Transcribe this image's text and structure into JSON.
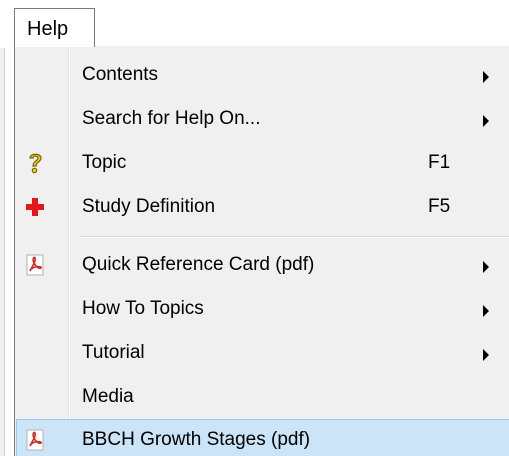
{
  "menu": {
    "title": "Help",
    "items": [
      {
        "label": "Contents",
        "shortcut": "",
        "submenu": true,
        "icon": ""
      },
      {
        "label": "Search for Help On...",
        "shortcut": "",
        "submenu": true,
        "icon": ""
      },
      {
        "label": "Topic",
        "shortcut": "F1",
        "submenu": false,
        "icon": "question-icon"
      },
      {
        "label": "Study Definition",
        "shortcut": "F5",
        "submenu": false,
        "icon": "red-cross-icon"
      },
      {
        "label": "Quick Reference Card (pdf)",
        "shortcut": "",
        "submenu": true,
        "icon": "pdf-icon"
      },
      {
        "label": "How To Topics",
        "shortcut": "",
        "submenu": true,
        "icon": ""
      },
      {
        "label": "Tutorial",
        "shortcut": "",
        "submenu": true,
        "icon": ""
      },
      {
        "label": "Media",
        "shortcut": "",
        "submenu": false,
        "icon": ""
      },
      {
        "label": "BBCH Growth Stages (pdf)",
        "shortcut": "",
        "submenu": false,
        "icon": "pdf-icon",
        "highlighted": true
      }
    ]
  },
  "colors": {
    "menu_background": "#f0f0f0",
    "highlight_background": "#cce4f7",
    "highlight_border": "#99c9ef",
    "cross_red": "#e3161b",
    "question_yellow": "#f2d21b",
    "pdf_red": "#d22a2a"
  }
}
